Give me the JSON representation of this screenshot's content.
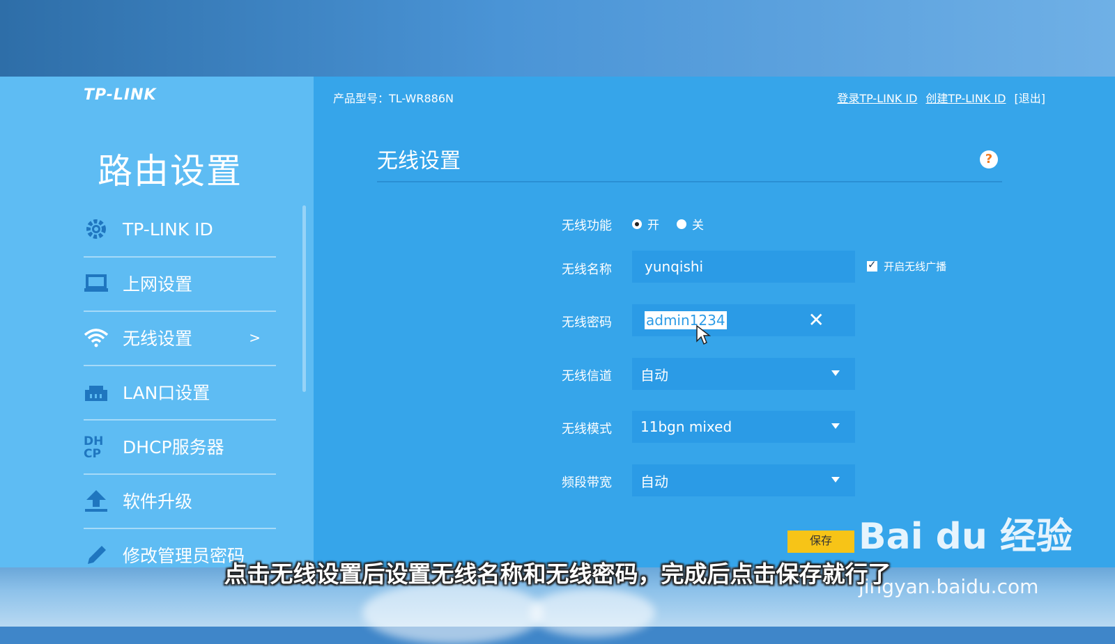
{
  "brand": {
    "logo": "TP-LINK",
    "sidebar_title": "路由设置"
  },
  "topbar": {
    "model": "产品型号：TL-WR886N",
    "links": [
      "登录TP-LINK ID",
      "创建TP-LINK ID",
      "[退出]"
    ]
  },
  "nav": {
    "items": [
      {
        "label": "TP-LINK ID",
        "icon": "gear-icon"
      },
      {
        "label": "上网设置",
        "icon": "laptop-icon"
      },
      {
        "label": "无线设置",
        "icon": "wifi-icon",
        "arrow": ">"
      },
      {
        "label": "LAN口设置",
        "icon": "lan-port-icon"
      },
      {
        "label": "DHCP服务器",
        "icon": "dhcp-icon"
      },
      {
        "label": "软件升级",
        "icon": "upload-icon"
      },
      {
        "label": "修改管理员密码",
        "icon": "pencil-icon"
      }
    ]
  },
  "page": {
    "title": "无线设置",
    "help": "?"
  },
  "form": {
    "wireless_function": {
      "label": "无线功能",
      "on": "开",
      "off": "关",
      "selected": "开"
    },
    "ssid": {
      "label": "无线名称",
      "value": "yunqishi",
      "broadcast_label": "开启无线广播",
      "broadcast_checked": true
    },
    "password": {
      "label": "无线密码",
      "value": "admin1234",
      "clear": "✕"
    },
    "channel": {
      "label": "无线信道",
      "value": "自动"
    },
    "mode": {
      "label": "无线模式",
      "value": "11bgn mixed"
    },
    "bandwidth": {
      "label": "频段带宽",
      "value": "自动"
    },
    "save_label": "保存"
  },
  "overlay": {
    "subtitle": "点击无线设置后设置无线名称和无线密码，完成后点击保存就行了",
    "watermark_logo": "Bai du 经验",
    "watermark_url": "jingyan.baidu.com"
  },
  "colors": {
    "sidebar": "#5ebcf3",
    "main": "#36a5ea",
    "field": "#2b9be6",
    "save": "#f7c417",
    "help": "#f07a20"
  }
}
